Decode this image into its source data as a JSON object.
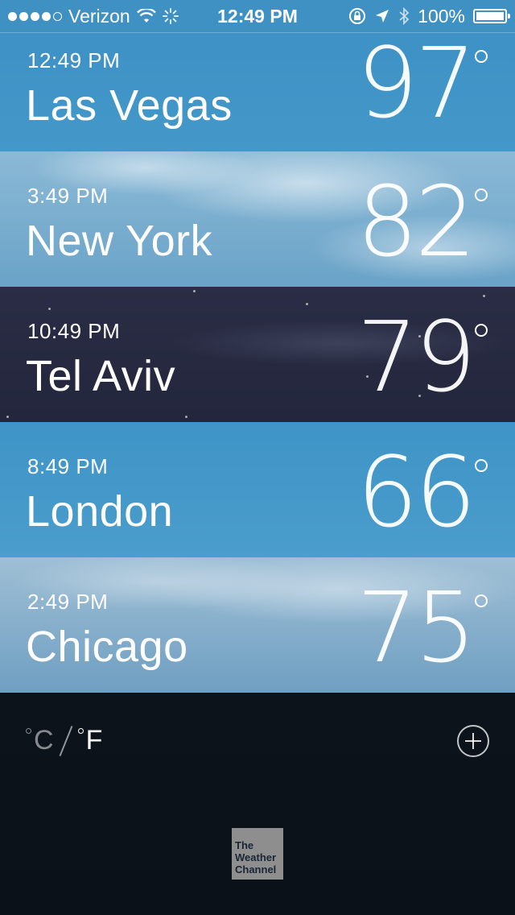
{
  "status_bar": {
    "carrier": "Verizon",
    "time": "12:49 PM",
    "battery_percent": "100%"
  },
  "cities": [
    {
      "time": "12:49 PM",
      "name": "Las Vegas",
      "temp": "97"
    },
    {
      "time": "3:49 PM",
      "name": "New York",
      "temp": "82"
    },
    {
      "time": "10:49 PM",
      "name": "Tel Aviv",
      "temp": "79"
    },
    {
      "time": "8:49 PM",
      "name": "London",
      "temp": "66"
    },
    {
      "time": "2:49 PM",
      "name": "Chicago",
      "temp": "75"
    }
  ],
  "footer": {
    "unit_c": "C",
    "unit_f": "F",
    "logo_text": [
      "The",
      "Weather",
      "Channel"
    ]
  }
}
